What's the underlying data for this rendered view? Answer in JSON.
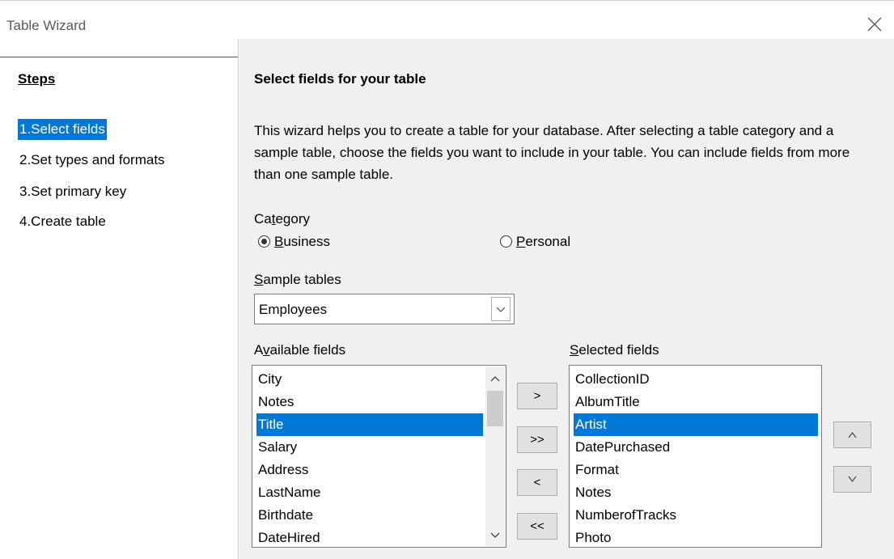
{
  "window": {
    "title": "Table Wizard"
  },
  "steps": {
    "heading": "Steps",
    "items": [
      {
        "label": "1.Select fields",
        "active": true
      },
      {
        "label": "2.Set types and formats",
        "active": false
      },
      {
        "label": "3.Set primary key",
        "active": false
      },
      {
        "label": "4.Create table",
        "active": false
      }
    ]
  },
  "page": {
    "title": "Select fields for your table",
    "description": "This wizard helps you to create a table for your database. After selecting a table category and a sample table, choose the fields you want to include in your table. You can include fields from more than one sample table."
  },
  "category": {
    "label_pre": "Ca",
    "label_key": "t",
    "label_post": "egory",
    "business": {
      "pre": "",
      "key": "B",
      "post": "usiness",
      "selected": true
    },
    "personal": {
      "pre": "",
      "key": "P",
      "post": "ersonal",
      "selected": false
    }
  },
  "sample_tables": {
    "label_pre": "",
    "label_key": "S",
    "label_post": "ample tables",
    "value": "Employees"
  },
  "available_fields": {
    "label_pre": "A",
    "label_key": "v",
    "label_post": "ailable fields",
    "items": [
      "City",
      "Notes",
      "Title",
      "Salary",
      "Address",
      "LastName",
      "Birthdate",
      "DateHired"
    ],
    "selected_index": 2
  },
  "selected_fields": {
    "label_pre": "",
    "label_key": "S",
    "label_post": "elected fields",
    "items": [
      "CollectionID",
      "AlbumTitle",
      "Artist",
      "DatePurchased",
      "Format",
      "Notes",
      "NumberofTracks",
      "Photo"
    ],
    "selected_index": 2
  },
  "move_buttons": {
    "add": ">",
    "add_all": ">>",
    "remove": "<",
    "remove_all": "<<"
  },
  "colors": {
    "accent": "#0078d7",
    "panel": "#f0f0f0"
  }
}
